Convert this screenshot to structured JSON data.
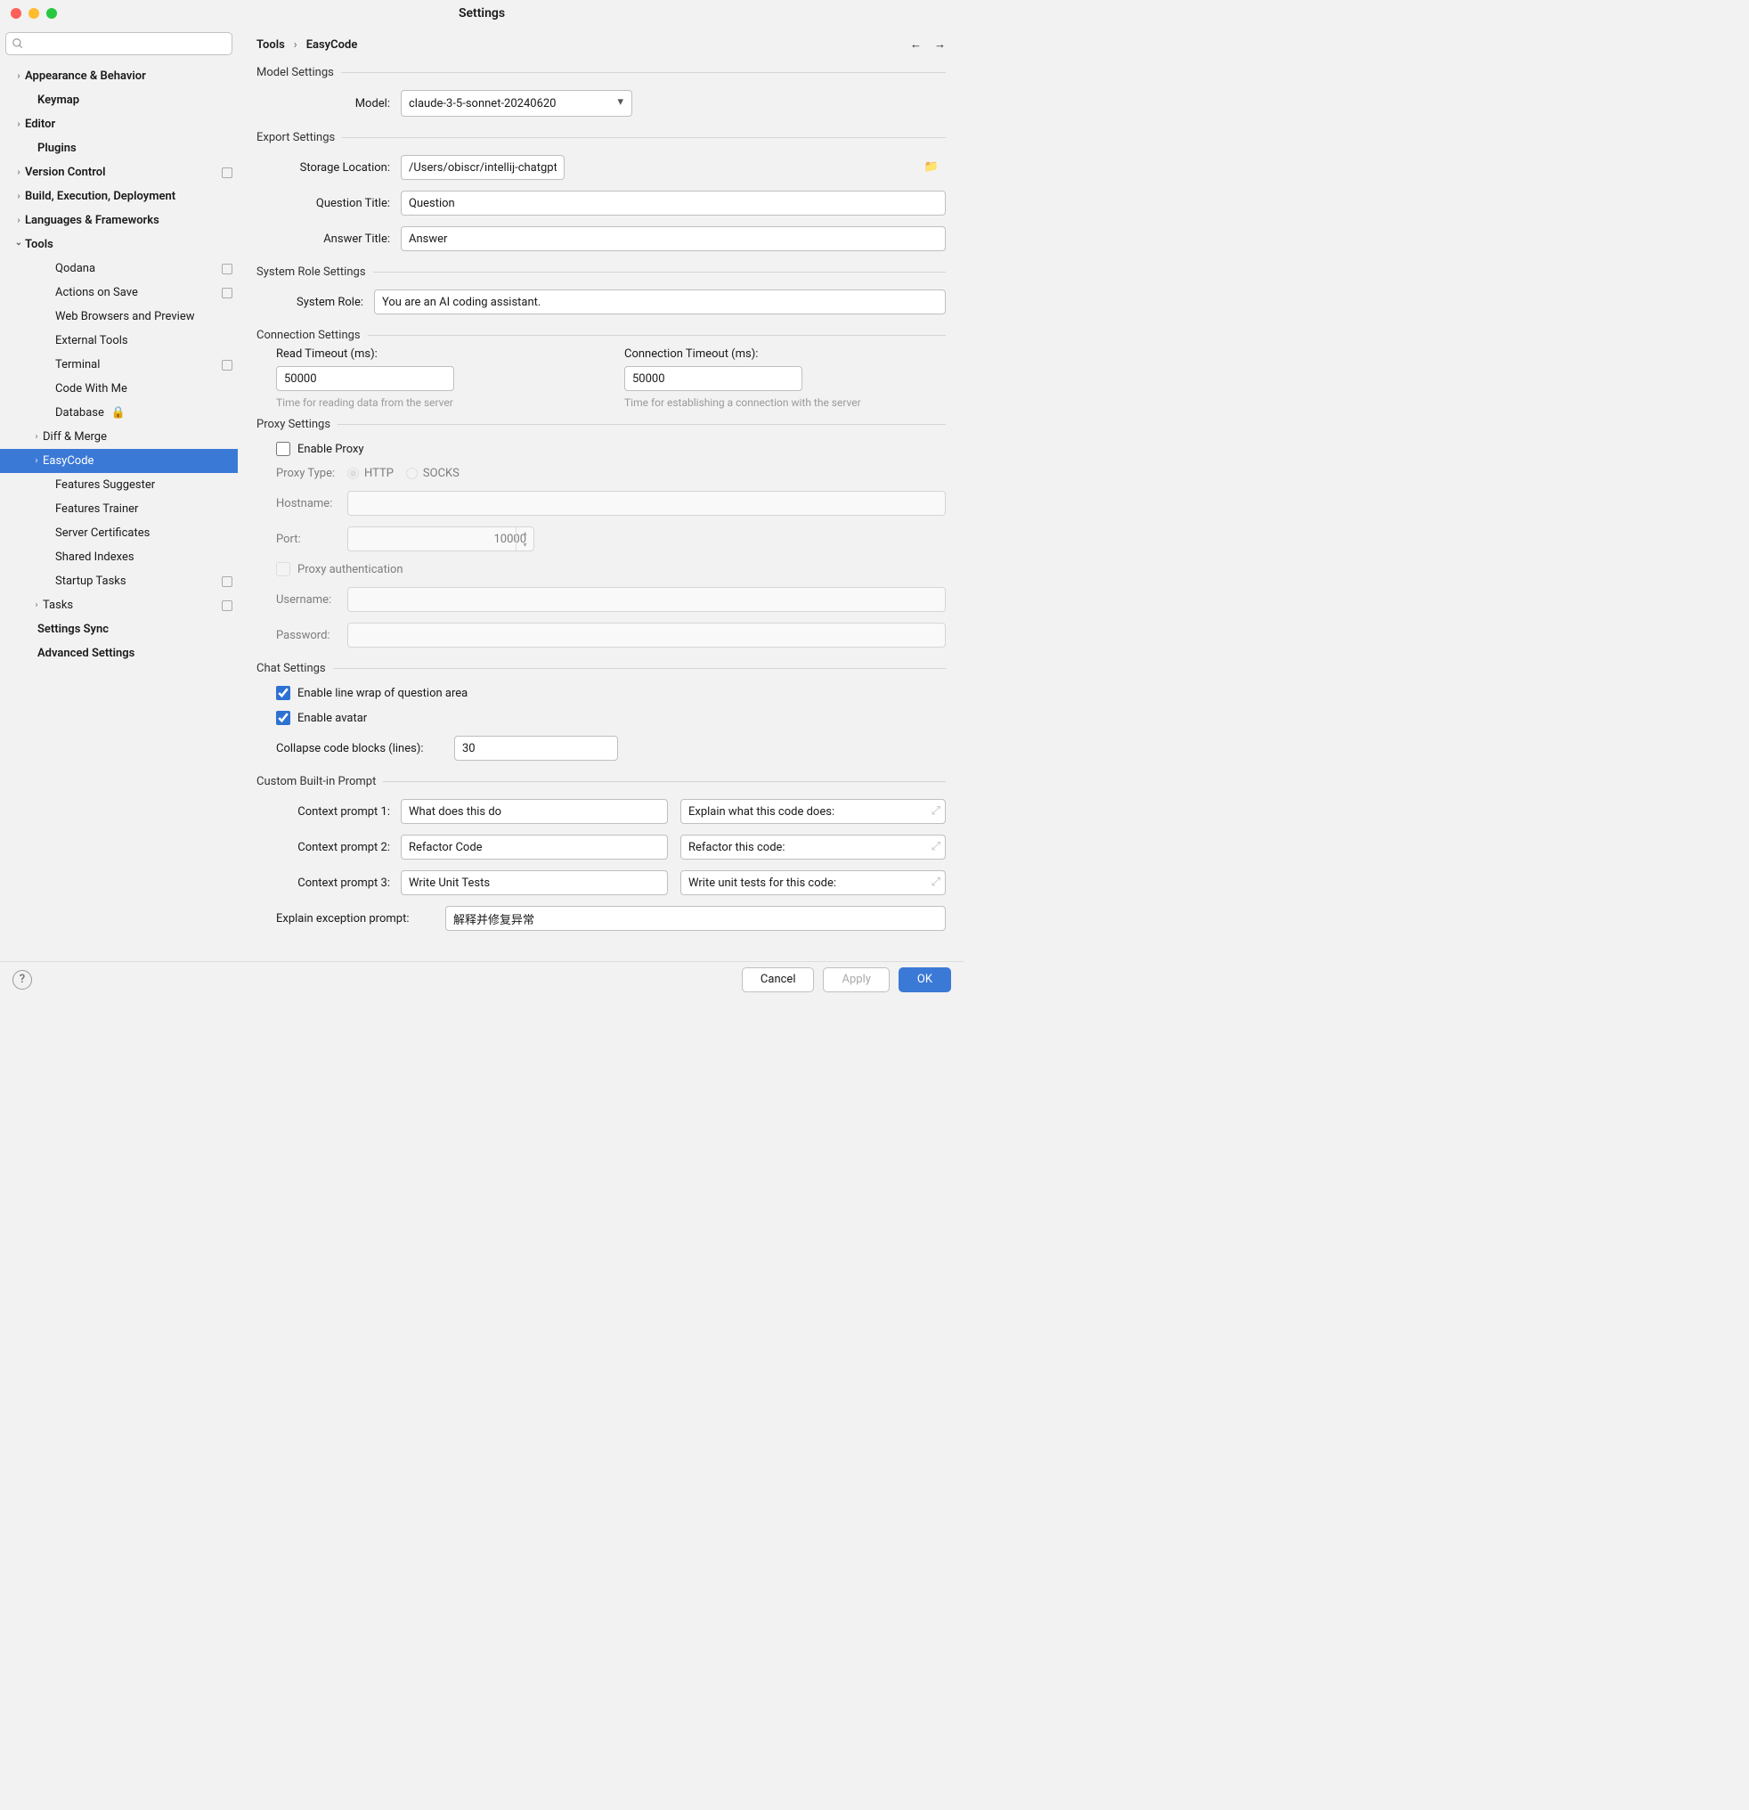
{
  "title": "Settings",
  "search_placeholder": "",
  "sidebar": [
    {
      "label": "Appearance & Behavior",
      "bold": true,
      "arrow": ">",
      "indent": 14
    },
    {
      "label": "Keymap",
      "bold": true,
      "arrow": "",
      "indent": 28
    },
    {
      "label": "Editor",
      "bold": true,
      "arrow": ">",
      "indent": 14
    },
    {
      "label": "Plugins",
      "bold": true,
      "arrow": "",
      "indent": 28
    },
    {
      "label": "Version Control",
      "bold": true,
      "arrow": ">",
      "indent": 14,
      "sq": true
    },
    {
      "label": "Build, Execution, Deployment",
      "bold": true,
      "arrow": ">",
      "indent": 14
    },
    {
      "label": "Languages & Frameworks",
      "bold": true,
      "arrow": ">",
      "indent": 14
    },
    {
      "label": "Tools",
      "bold": true,
      "arrow": "v",
      "indent": 14
    },
    {
      "label": "Qodana",
      "indent": 48,
      "sq": true
    },
    {
      "label": "Actions on Save",
      "indent": 48,
      "sq": true
    },
    {
      "label": "Web Browsers and Preview",
      "indent": 48
    },
    {
      "label": "External Tools",
      "indent": 48
    },
    {
      "label": "Terminal",
      "indent": 48,
      "sq": true
    },
    {
      "label": "Code With Me",
      "indent": 48
    },
    {
      "label": "Database",
      "indent": 48,
      "lock": true
    },
    {
      "label": "Diff & Merge",
      "indent": 34,
      "arrow": ">"
    },
    {
      "label": "EasyCode",
      "indent": 34,
      "arrow": ">",
      "sel": true
    },
    {
      "label": "Features Suggester",
      "indent": 48
    },
    {
      "label": "Features Trainer",
      "indent": 48
    },
    {
      "label": "Server Certificates",
      "indent": 48
    },
    {
      "label": "Shared Indexes",
      "indent": 48
    },
    {
      "label": "Startup Tasks",
      "indent": 48,
      "sq": true
    },
    {
      "label": "Tasks",
      "indent": 34,
      "arrow": ">",
      "sq": true
    },
    {
      "label": "Settings Sync",
      "bold": true,
      "indent": 28
    },
    {
      "label": "Advanced Settings",
      "bold": true,
      "indent": 28
    }
  ],
  "crumb1": "Tools",
  "crumb2": "EasyCode",
  "s_model": "Model Settings",
  "model_k": "Model:",
  "model_v": "claude-3-5-sonnet-20240620",
  "s_export": "Export Settings",
  "storage_k": "Storage Location:",
  "storage_v": "/Users/obiscr/intellij-chatgpt/export/easycode",
  "qtitle_k": "Question Title:",
  "qtitle_v": "Question",
  "atitle_k": "Answer Title:",
  "atitle_v": "Answer",
  "s_role": "System Role Settings",
  "role_k": "System Role:",
  "role_v": "You are an AI coding assistant.",
  "s_conn": "Connection Settings",
  "rto_k": "Read Timeout (ms):",
  "rto_v": "50000",
  "rto_h": "Time for reading data from the server",
  "cto_k": "Connection Timeout (ms):",
  "cto_v": "50000",
  "cto_h": "Time for establishing a connection with the server",
  "s_proxy": "Proxy Settings",
  "proxy_enable": "Enable Proxy",
  "proxy_type_k": "Proxy Type:",
  "proxy_http": "HTTP",
  "proxy_socks": "SOCKS",
  "host_k": "Hostname:",
  "port_k": "Port:",
  "port_v": "10000",
  "proxy_auth": "Proxy authentication",
  "user_k": "Username:",
  "pass_k": "Password:",
  "s_chat": "Chat Settings",
  "chat_wrap": "Enable line wrap of question area",
  "chat_avatar": "Enable avatar",
  "collapse_k": "Collapse code blocks (lines):",
  "collapse_v": "30",
  "s_prompt": "Custom Built-in Prompt",
  "cp1_k": "Context prompt 1:",
  "cp1_a": "What does this do",
  "cp1_b": "Explain what this code does:",
  "cp2_k": "Context prompt 2:",
  "cp2_a": "Refactor Code",
  "cp2_b": "Refactor this code:",
  "cp3_k": "Context prompt 3:",
  "cp3_a": "Write Unit Tests",
  "cp3_b": "Write unit tests for this code:",
  "exc_k": "Explain exception prompt:",
  "exc_v": "解释并修复异常",
  "btn_cancel": "Cancel",
  "btn_apply": "Apply",
  "btn_ok": "OK",
  "help": "?"
}
